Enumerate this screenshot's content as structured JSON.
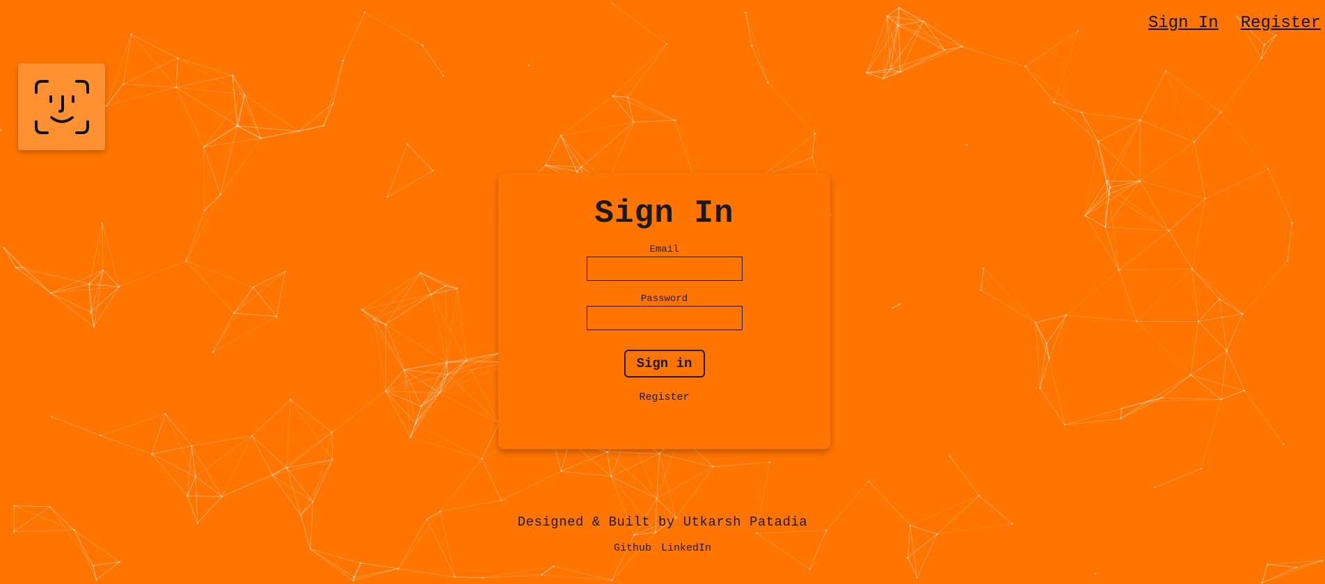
{
  "nav": {
    "signin_label": "Sign In",
    "register_label": "Register"
  },
  "logo": {
    "icon": "face-id-icon"
  },
  "form": {
    "title": "Sign In",
    "email_label": "Email",
    "email_value": "",
    "password_label": "Password",
    "password_value": "",
    "submit_label": "Sign in",
    "register_link": "Register"
  },
  "footer": {
    "credit": "Designed & Built by Utkarsh Patadia",
    "github_label": "Github",
    "linkedin_label": "LinkedIn"
  },
  "colors": {
    "background": "#ff7500",
    "logo_tile": "#ff9133",
    "text": "#1a1a1a",
    "network_lines": "#ffffff"
  }
}
